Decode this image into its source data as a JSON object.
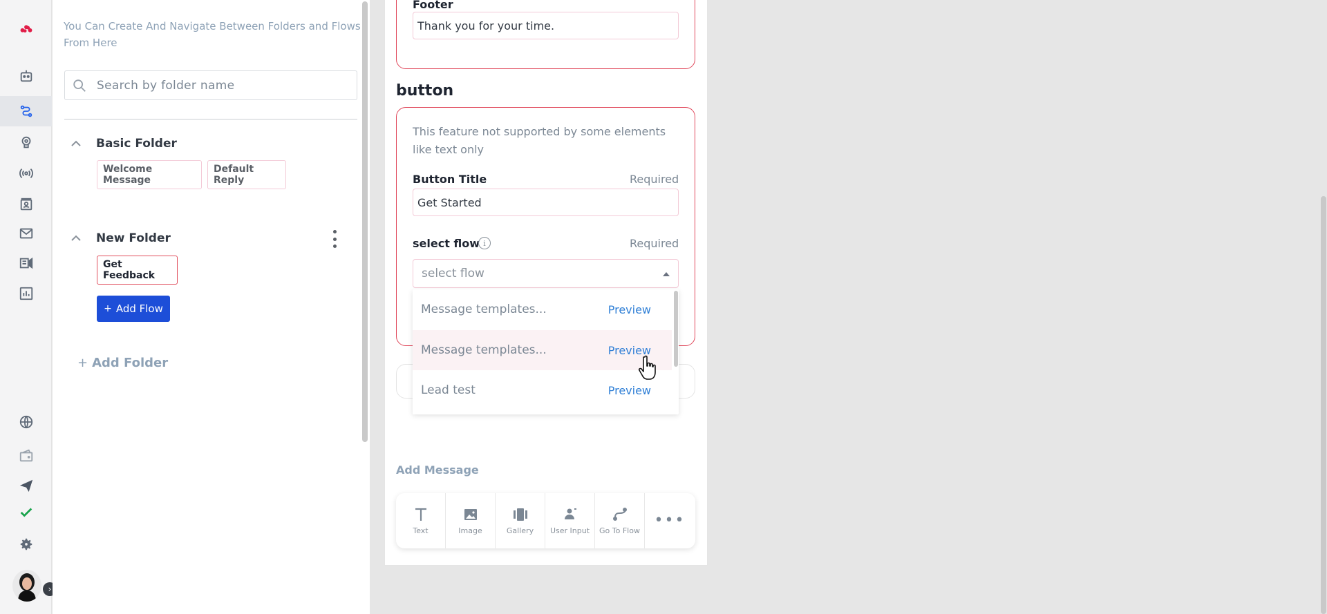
{
  "sidebar": {
    "icons": [
      "logo-icon",
      "bot-icon",
      "flow-icon",
      "brain-icon",
      "broadcast-icon",
      "contacts-icon",
      "mail-icon",
      "campaign-icon",
      "analytics-icon",
      "globe-icon",
      "wallet-icon",
      "send-icon",
      "check-icon",
      "settings-icon"
    ],
    "active": "flow-icon"
  },
  "folders_panel": {
    "description": "You Can Create And Navigate Between Folders and Flows From Here",
    "search": {
      "placeholder": "Search by folder name"
    },
    "folders": [
      {
        "name": "Basic Folder",
        "flows": [
          "Welcome Message",
          "Default Reply"
        ]
      },
      {
        "name": "New Folder",
        "flows": [
          "Get Feedback"
        ],
        "selected_flow": "Get Feedback"
      }
    ],
    "add_flow_label": "Add Flow",
    "add_folder_label": "Add Folder",
    "add_icon": "+"
  },
  "editor": {
    "footer": {
      "label": "Footer",
      "value": "Thank you for your time."
    },
    "button_section": {
      "title": "button",
      "note": "This feature not supported by some elements like text only",
      "button_title": {
        "label": "Button Title",
        "required": "Required",
        "value": "Get Started"
      },
      "select_flow": {
        "label": "select flow",
        "required": "Required",
        "placeholder": "select flow",
        "info_icon": "i"
      }
    },
    "dropdown": {
      "items": [
        {
          "name": "Message templates...",
          "action": "Preview"
        },
        {
          "name": "Message templates...",
          "action": "Preview"
        },
        {
          "name": "Lead test",
          "action": "Preview"
        }
      ],
      "hovered_index": 1
    },
    "add_message_label": "Add Message",
    "toolbar": [
      {
        "label": "Text",
        "icon": "text-icon"
      },
      {
        "label": "Image",
        "icon": "image-icon"
      },
      {
        "label": "Gallery",
        "icon": "gallery-icon"
      },
      {
        "label": "User Input",
        "icon": "user-input-icon"
      },
      {
        "label": "Go To Flow",
        "icon": "go-to-flow-icon"
      },
      {
        "label": "",
        "icon": "more-icon"
      }
    ]
  },
  "colors": {
    "accent": "#1d4ed8",
    "danger_border": "#e0475a",
    "link": "#2f7fd6"
  }
}
